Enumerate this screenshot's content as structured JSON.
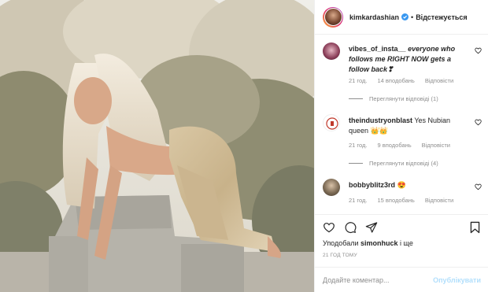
{
  "header": {
    "username": "kimkardashian",
    "follow_label": "Відстежується",
    "separator": "•"
  },
  "comments": [
    {
      "username": "vibes_of_insta__",
      "text": "everyone who follows me RIGHT NOW gets a follow back❣",
      "time": "21 год.",
      "likes": "14 вподобань",
      "reply": "Відповісти",
      "view_replies": "Переглянути відповіді (1)"
    },
    {
      "username": "theindustryonblast",
      "text": "Yes Nubian queen 👑👑",
      "time": "21 год.",
      "likes": "9 вподобань",
      "reply": "Відповісти",
      "view_replies": "Переглянути відповіді (4)"
    },
    {
      "username": "bobbyblitz3rd",
      "text": "😍",
      "time": "21 год.",
      "likes": "15 вподобань",
      "reply": "Відповісти"
    }
  ],
  "likes": {
    "prefix": "Уподобали",
    "user": "simonhuck",
    "suffix": "і ще"
  },
  "timestamp": "21 ГОД ТОМУ",
  "add_comment": {
    "placeholder": "Додайте коментар...",
    "publish_label": "Опублікувати"
  },
  "colors": {
    "verified": "#3897f0",
    "muted": "#8e8e8e",
    "publish_disabled": "#b2dffc"
  }
}
